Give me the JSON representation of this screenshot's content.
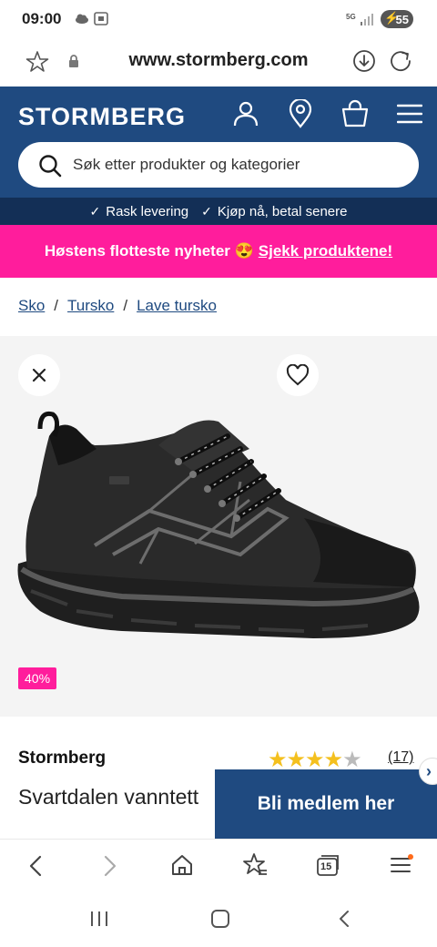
{
  "status_bar": {
    "time": "09:00",
    "battery": "55"
  },
  "browser": {
    "url": "www.stormberg.com"
  },
  "site": {
    "logo": "STORMBERG",
    "search_placeholder": "Søk etter produkter og kategorier",
    "usp": [
      "Rask levering",
      "Kjøp nå, betal senere"
    ],
    "promo_text": "Høstens flotteste nyheter 😍",
    "promo_link": "Sjekk produktene!"
  },
  "breadcrumb": [
    "Sko",
    "Tursko",
    "Lave tursko"
  ],
  "product": {
    "discount_badge": "40%",
    "brand": "Stormberg",
    "rating": 4,
    "rating_max": 5,
    "review_count": "(17)",
    "name": "Svartdalen vanntett"
  },
  "member_cta": "Bli medlem her",
  "browser_toolbar": {
    "tab_count": "15"
  },
  "colors": {
    "brand_blue": "#1f4a80",
    "dark_blue": "#132f56",
    "promo_pink": "#ff1d9c",
    "star": "#f4c01e"
  }
}
